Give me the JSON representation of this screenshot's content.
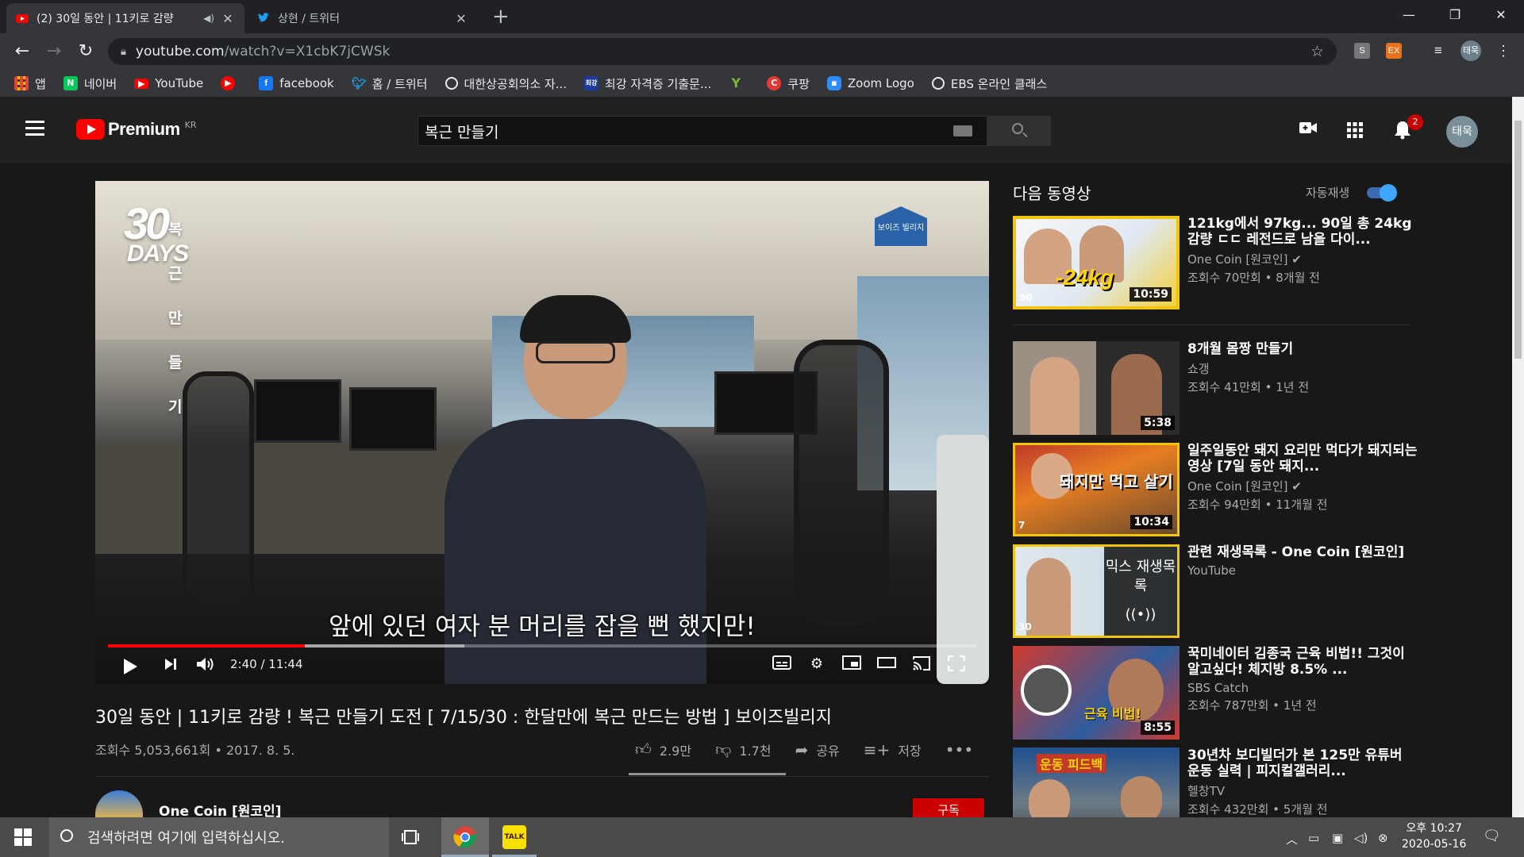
{
  "browser": {
    "tabs": [
      {
        "title": "(2) 30일 동안 | 11키로 감량"
      },
      {
        "title": "상현 / 트위터"
      }
    ],
    "url_host": "youtube.com",
    "url_path": "/watch?v=X1cbK7jCWSk",
    "bookmarks": [
      {
        "label": "앱",
        "icon": "apps-grid-icon"
      },
      {
        "label": "네이버",
        "icon": "naver-icon"
      },
      {
        "label": "YouTube",
        "icon": "youtube-icon"
      },
      {
        "label": "",
        "icon": "youtube-music-icon"
      },
      {
        "label": "facebook",
        "icon": "facebook-icon"
      },
      {
        "label": "홈 / 트위터",
        "icon": "twitter-icon"
      },
      {
        "label": "대한상공회의소 자...",
        "icon": "globe-icon"
      },
      {
        "label": "최강 자격증 기출문...",
        "icon": "site-icon"
      },
      {
        "label": "",
        "icon": "y-icon"
      },
      {
        "label": "쿠팡",
        "icon": "coupang-icon"
      },
      {
        "label": "Zoom Logo",
        "icon": "zoom-icon"
      },
      {
        "label": "EBS 온라인 클래스",
        "icon": "globe-icon"
      }
    ],
    "extensions": [
      "S",
      "EX"
    ],
    "profile": "태욱"
  },
  "youtube": {
    "logo_text": "Premium",
    "logo_region": "KR",
    "search_value": "복근 만들기",
    "notification_count": "2",
    "avatar_text": "태욱"
  },
  "player": {
    "brand_big": "30",
    "brand_days": "DAYS",
    "brand_sub": "복근만들기",
    "channel_mark": "보이즈 빌리지",
    "subtitle": "앞에 있던 여자 분 머리를 잡을 뻔 했지만!",
    "time": "2:40 / 11:44",
    "played_fraction": 0.227,
    "buffered_fraction": 0.41
  },
  "video": {
    "title": "30일 동안 | 11키로 감량 ! 복근 만들기 도전 [ 7/15/30 : 한달만에 복근 만드는 방법 ] 보이즈빌리지",
    "meta": "조회수 5,053,661회 • 2017. 8. 5.",
    "likes": "2.9만",
    "dislikes": "1.7천",
    "share": "공유",
    "save": "저장",
    "channel": "One Coin [원코인]",
    "subscribe": "구독"
  },
  "sidebar": {
    "upnext": "다음 동영상",
    "autoplay": "자동재생",
    "items": [
      {
        "title": "121kg에서 97kg... 90일 총 24kg 감량 ㄷㄷ 레전드로 남을 다이...",
        "channel": "One Coin [원코인]",
        "views": "조회수 70만회 • 8개월 전",
        "duration": "10:59",
        "thumb_text": "-24kg",
        "corner": "90"
      },
      {
        "title": "8개월 몸짱 만들기",
        "channel": "쇼갱",
        "views": "조회수 41만회 • 1년 전",
        "duration": "5:38",
        "thumb_text": "",
        "corner": ""
      },
      {
        "title": "일주일동안 돼지 요리만 먹다가 돼지되는 영상 [7일 동안 돼지...",
        "channel": "One Coin [원코인]",
        "views": "조회수 94만회 • 11개월 전",
        "duration": "10:34",
        "thumb_text": "돼지만 먹고 살기",
        "corner": "7"
      },
      {
        "title": "관련 재생목록 - One Coin [원코인]",
        "channel": "YouTube",
        "views": "",
        "duration": "",
        "thumb_text": "믹스 재생목록",
        "corner": "30"
      },
      {
        "title": "꾹미네이터 김종국 근육 비법!! 그것이 알고싶다! 체지방 8.5% ...",
        "channel": "SBS Catch",
        "views": "조회수 787만회 • 1년 전",
        "duration": "8:55",
        "thumb_text": "근육 비법!",
        "corner": ""
      },
      {
        "title": "30년차 보디빌더가 본 125만 유튜버 운동 실력 | 피지컬갤러리...",
        "channel": "헬창TV",
        "views": "조회수 432만회 • 5개월 전",
        "duration": "",
        "thumb_text": "운동 피드백",
        "corner": ""
      }
    ]
  },
  "taskbar": {
    "search_placeholder": "검색하려면 여기에 입력하십시오.",
    "time": "오후 10:27",
    "date": "2020-05-16"
  }
}
